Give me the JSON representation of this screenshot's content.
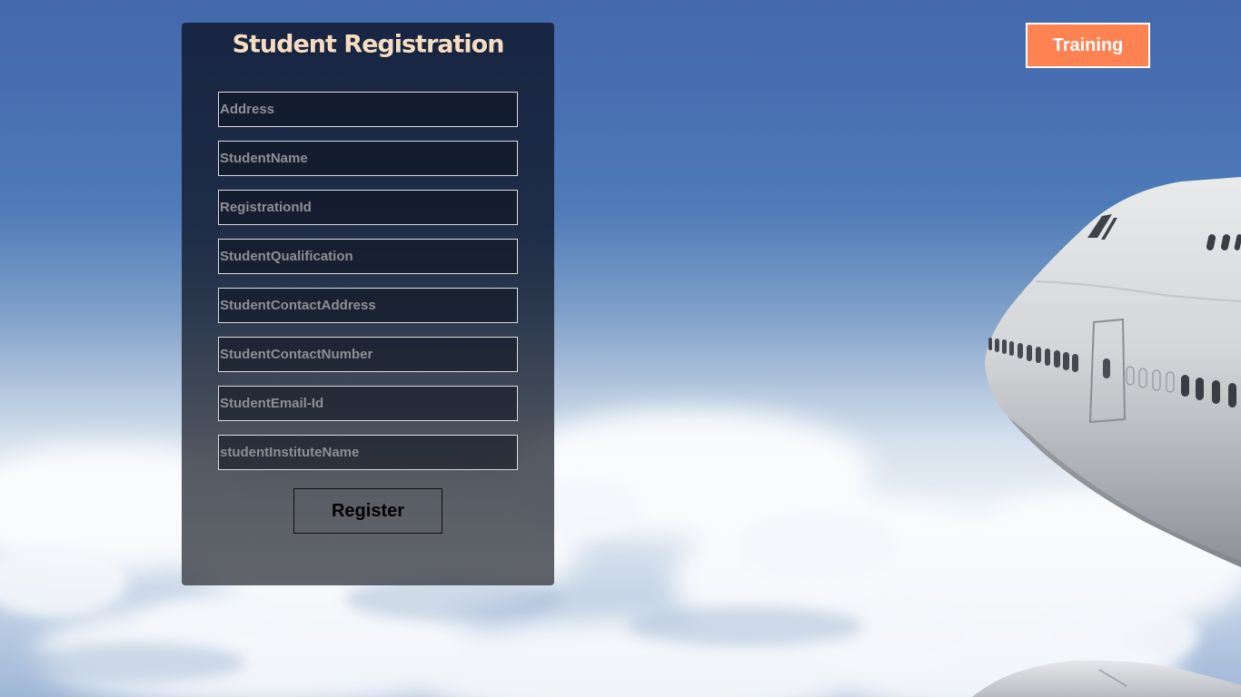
{
  "form": {
    "title": "Student Registration",
    "fields": [
      {
        "placeholder": "Address",
        "value": ""
      },
      {
        "placeholder": "StudentName",
        "value": ""
      },
      {
        "placeholder": "RegistrationId",
        "value": ""
      },
      {
        "placeholder": "StudentQualification",
        "value": ""
      },
      {
        "placeholder": "StudentContactAddress",
        "value": ""
      },
      {
        "placeholder": "StudentContactNumber",
        "value": ""
      },
      {
        "placeholder": "StudentEmail-Id",
        "value": ""
      },
      {
        "placeholder": "studentInstituteName",
        "value": ""
      }
    ],
    "submit_label": "Register"
  },
  "header": {
    "training_label": "Training"
  },
  "colors": {
    "title": "#f6dcc2",
    "accent_button": "#ff8252",
    "sky": "#4469ad"
  }
}
